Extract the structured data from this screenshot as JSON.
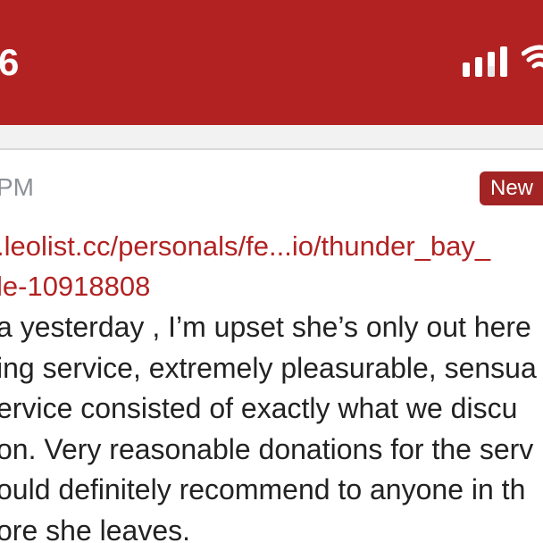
{
  "status_bar": {
    "time": "6",
    "signal_icon": "cellular-signal-icon",
    "wifi_icon": "wifi-icon",
    "color": "#b22222"
  },
  "post": {
    "time": "PM",
    "badge": "New",
    "link_lines": [
      ".leolist.cc/personals/fe...io/thunder_bay_",
      "le-10918808"
    ],
    "body_lines": [
      "a yesterday , I’m upset she’s only out here",
      "ing service, extremely pleasurable, sensua",
      "ervice consisted of exactly what we discu",
      "on. Very reasonable donations for the serv",
      "ould definitely recommend to anyone in th",
      "ore she leaves."
    ],
    "link_color": "#b22222",
    "badge_color": "#a32424"
  }
}
